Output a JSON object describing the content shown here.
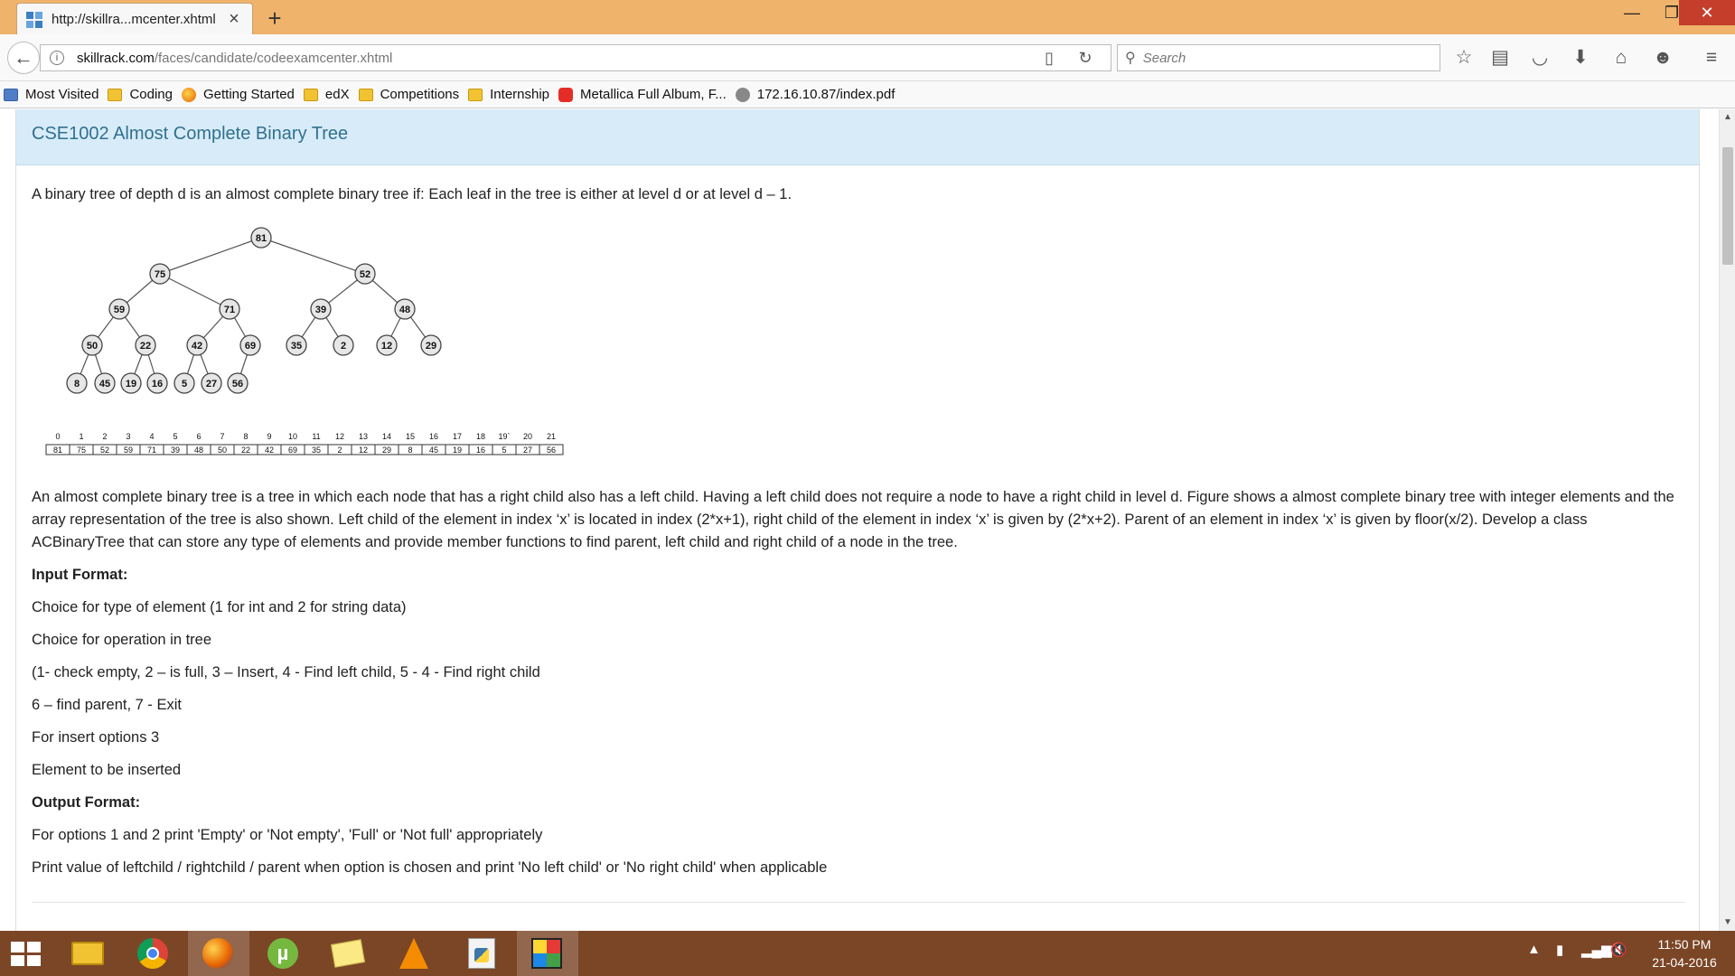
{
  "browser": {
    "tab_title": "http://skillra...mcenter.xhtml",
    "url_host": "skillrack.com",
    "url_path": "/faces/candidate/codeexamcenter.xhtml",
    "search_placeholder": "Search"
  },
  "bookmarks": [
    {
      "label": "Most Visited",
      "icon": "bookmark-star-icon"
    },
    {
      "label": "Coding",
      "icon": "folder-icon"
    },
    {
      "label": "Getting Started",
      "icon": "firefox-icon"
    },
    {
      "label": "edX",
      "icon": "folder-icon"
    },
    {
      "label": "Competitions",
      "icon": "folder-icon"
    },
    {
      "label": "Internship",
      "icon": "folder-icon"
    },
    {
      "label": "Metallica Full Album, F...",
      "icon": "youtube-icon"
    },
    {
      "label": "172.16.10.87/index.pdf",
      "icon": "globe-icon"
    }
  ],
  "page": {
    "title": "CSE1002 Almost Complete Binary Tree",
    "intro": "A binary tree of depth d is an almost complete binary tree if: Each leaf in the tree is either at level d or at level d – 1.",
    "description": "An almost complete binary tree is a tree in which each node that has a right child also has a left child. Having a left child does not require a node to have a right child in level d. Figure shows a almost complete binary tree with integer elements and the array representation of the tree is also shown. Left child of the element in index ‘x’ is located in index (2*x+1), right child of the element in index ‘x’ is given by (2*x+2). Parent of an element in index ‘x’ is given by floor(x/2). Develop a class ACBinaryTree that can store any type of elements and provide member functions to find parent, left child and right child of a node in the tree.",
    "input_format_heading": "Input Format:",
    "input_lines": [
      "Choice for type of element (1 for int and 2 for string data)",
      "Choice for operation in tree",
      "(1- check empty, 2 – is full, 3 – Insert, 4 - Find left child, 5 - 4 - Find right child",
      "6 – find parent, 7 - Exit",
      "For insert options 3",
      "Element to be inserted"
    ],
    "output_format_heading": "Output Format:",
    "output_lines": [
      "For options 1 and 2 print 'Empty' or 'Not empty', 'Full' or 'Not full' appropriately",
      "Print value of leftchild / rightchild / parent when option is chosen and print 'No left child' or 'No right child' when applicable"
    ]
  },
  "figure": {
    "tree_values": [
      81,
      75,
      52,
      59,
      71,
      39,
      48,
      50,
      22,
      42,
      69,
      35,
      2,
      12,
      29,
      8,
      45,
      19,
      16,
      5,
      27,
      56
    ],
    "array_indices": [
      "0",
      "1",
      "2",
      "3",
      "4",
      "5",
      "6",
      "7",
      "8",
      "9",
      "10",
      "11",
      "12",
      "13",
      "14",
      "15",
      "16",
      "17",
      "18",
      "19`",
      "20",
      "21"
    ],
    "array_values": [
      "81",
      "75",
      "52",
      "59",
      "71",
      "39",
      "48",
      "50",
      "22",
      "42",
      "69",
      "35",
      "2",
      "12",
      "29",
      "8",
      "45",
      "19",
      "16",
      "5",
      "27",
      "56"
    ]
  },
  "taskbar": {
    "clock_time": "11:50 PM",
    "clock_date": "21-04-2016"
  },
  "colors": {
    "titlebar": "#f0b36b",
    "header_bg": "#d7ecf8",
    "header_text": "#31708f",
    "taskbar": "#7b4626"
  }
}
